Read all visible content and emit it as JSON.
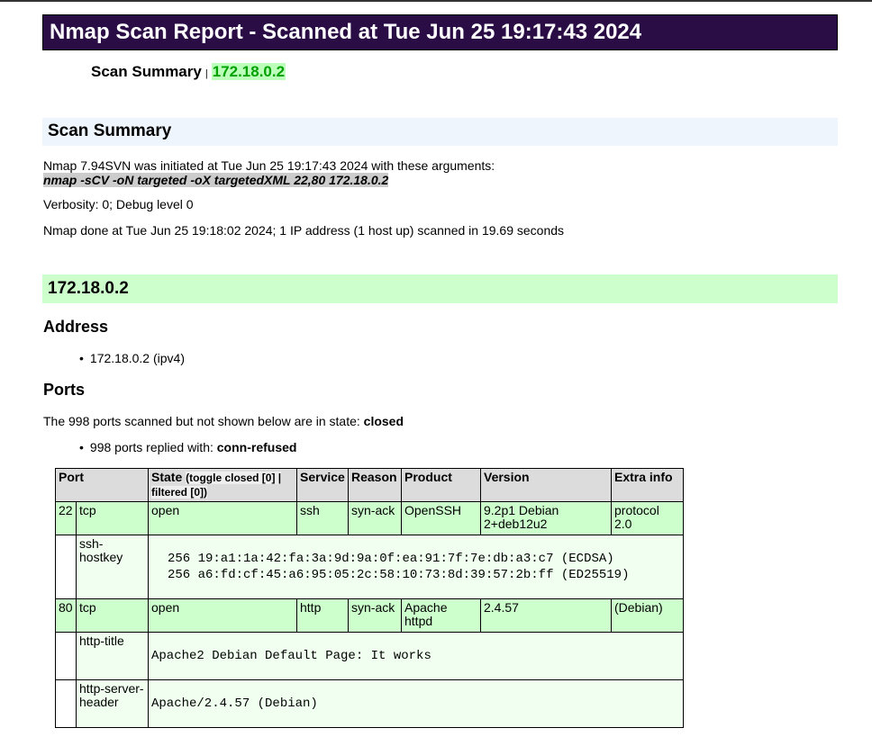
{
  "title": "Nmap Scan Report - Scanned at Tue Jun 25 19:17:43 2024",
  "nav": {
    "summary": "Scan Summary",
    "separator": "|",
    "host": "172.18.0.2"
  },
  "scan_summary": {
    "heading": "Scan Summary",
    "initiated": "Nmap 7.94SVN was initiated at Tue Jun 25 19:17:43 2024 with these arguments:",
    "args": "nmap -sCV -oN targeted -oX targetedXML 22,80 172.18.0.2",
    "verbosity": "Verbosity: 0; Debug level 0",
    "done": "Nmap done at Tue Jun 25 19:18:02 2024; 1 IP address (1 host up) scanned in 19.69 seconds"
  },
  "host": {
    "heading": "172.18.0.2",
    "address_heading": "Address",
    "address": "172.18.0.2 (ipv4)",
    "ports_heading": "Ports",
    "closed_prefix": "The 998 ports scanned but not shown below are in state: ",
    "closed_state": "closed",
    "replied_prefix": "998 ports replied with: ",
    "replied_reason": "conn-refused"
  },
  "table": {
    "headers": {
      "port": "Port",
      "state": "State",
      "toggle": "(toggle closed [0] | filtered [0])",
      "service": "Service",
      "reason": "Reason",
      "product": "Product",
      "version": "Version",
      "extra": "Extra info"
    },
    "rows": [
      {
        "port": "22",
        "proto": "tcp",
        "state": "open",
        "service": "ssh",
        "reason": "syn-ack",
        "product": "OpenSSH",
        "version": "9.2p1 Debian 2+deb12u2",
        "extra": "protocol 2.0",
        "script_name": "ssh-hostkey",
        "script_output": "256 19:a1:1a:42:fa:3a:9d:9a:0f:ea:91:7f:7e:db:a3:c7 (ECDSA)\n256 a6:fd:cf:45:a6:95:05:2c:58:10:73:8d:39:57:2b:ff (ED25519)"
      },
      {
        "port": "80",
        "proto": "tcp",
        "state": "open",
        "service": "http",
        "reason": "syn-ack",
        "product": "Apache httpd",
        "version": "2.4.57",
        "extra": "(Debian)",
        "script_name": "http-title",
        "script_output": "Apache2 Debian Default Page: It works",
        "script2_name": "http-server-header",
        "script2_output": "Apache/2.4.57 (Debian)"
      }
    ]
  }
}
